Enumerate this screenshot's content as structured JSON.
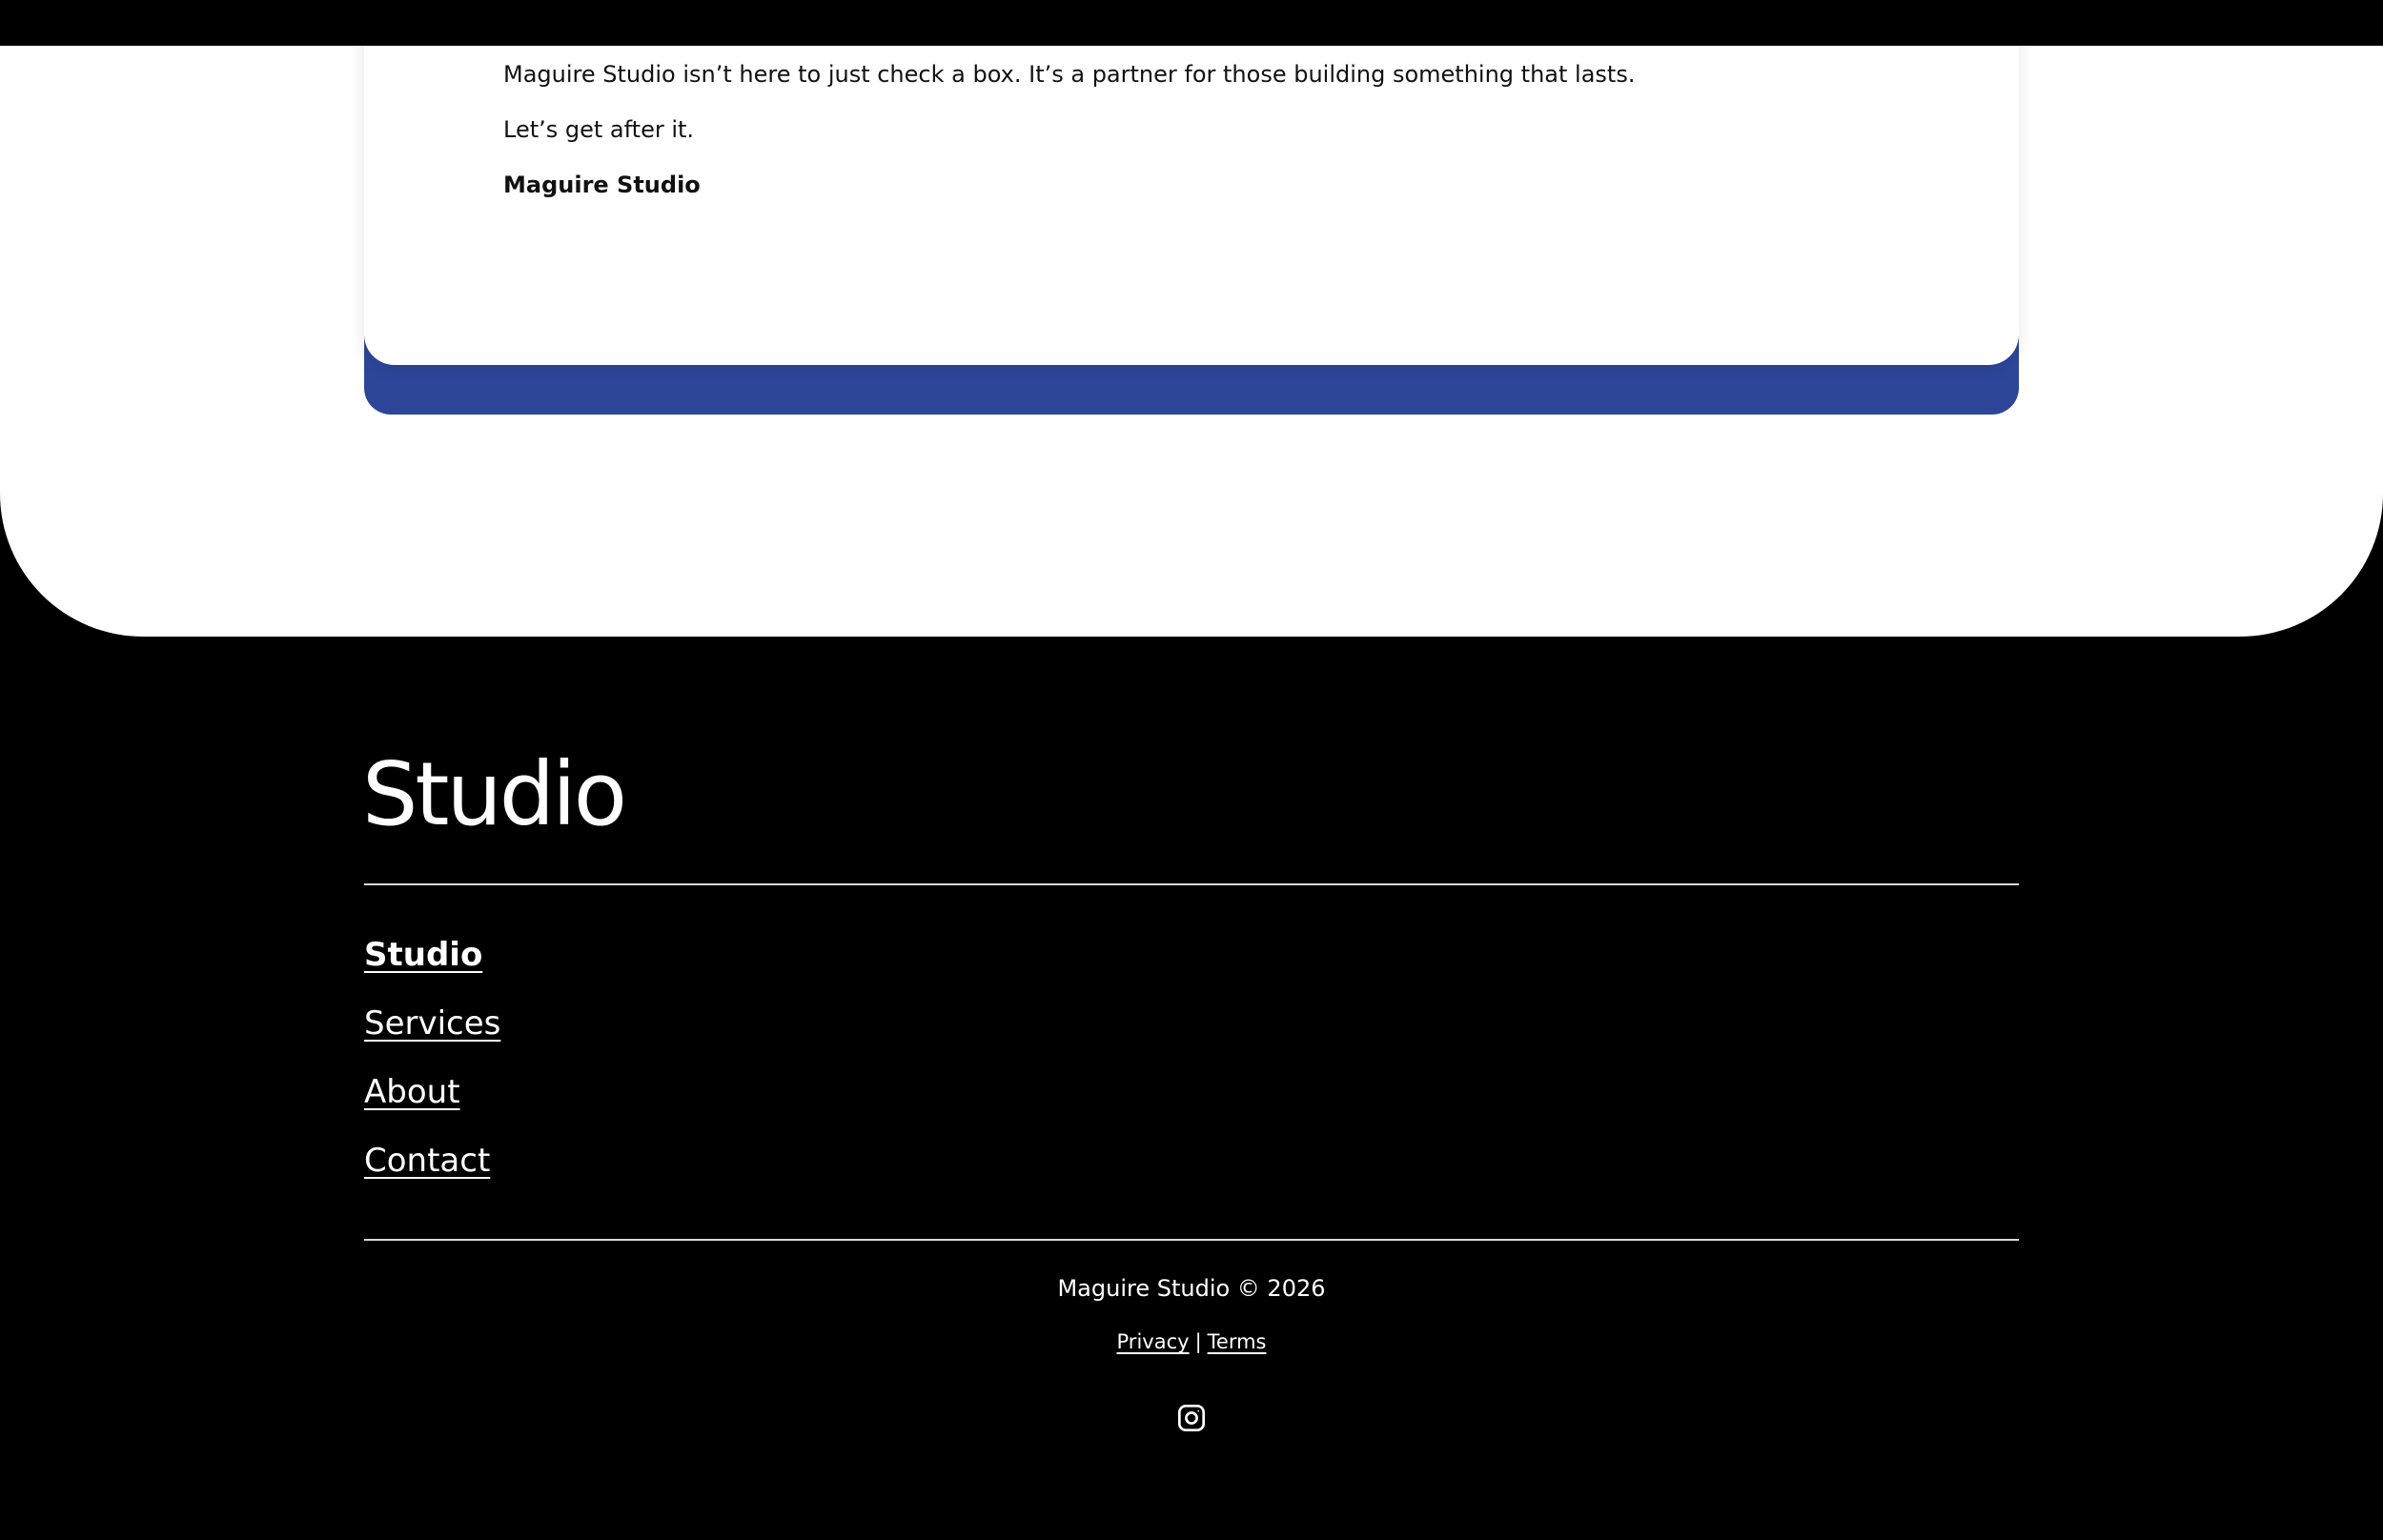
{
  "card": {
    "paragraph_1": "Maguire Studio isn’t here to just check a box. It’s a partner for those building something that lasts.",
    "paragraph_2": "Let’s get after it.",
    "signature": "Maguire Studio"
  },
  "footer": {
    "logo_text": "Studio",
    "nav": [
      {
        "label": "Studio",
        "active": true
      },
      {
        "label": "Services",
        "active": false
      },
      {
        "label": "About",
        "active": false
      },
      {
        "label": "Contact",
        "active": false
      }
    ],
    "copyright": "Maguire Studio © 2026",
    "legal": {
      "privacy": "Privacy",
      "separator": "|",
      "terms": "Terms"
    },
    "social_icon": "instagram-icon"
  },
  "colors": {
    "background": "#000000",
    "surface": "#ffffff",
    "accent": "#2e4699",
    "text_dark": "#111111",
    "text_light": "#ffffff"
  }
}
